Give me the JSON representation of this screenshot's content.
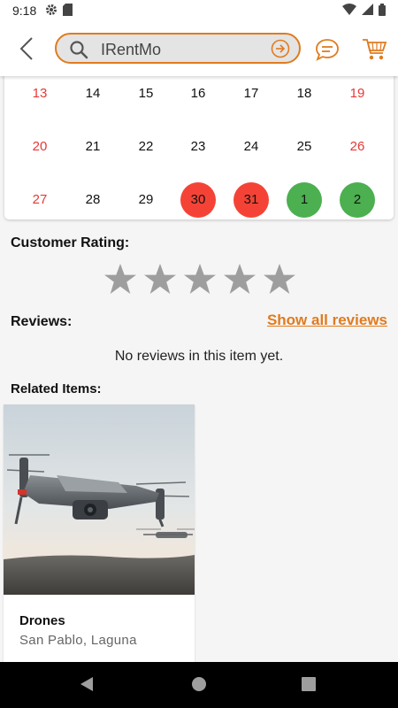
{
  "status_bar": {
    "time": "9:18",
    "left_icons": [
      "gear-icon",
      "sd-card-icon"
    ],
    "right_icons": [
      "wifi-icon",
      "signal-icon",
      "battery-icon"
    ]
  },
  "header": {
    "search": {
      "value": "IRentMo",
      "placeholder": ""
    },
    "icons": [
      "back-chevron-icon",
      "search-icon",
      "arrow-circle-right-icon",
      "chat-bubble-icon",
      "cart-icon"
    ],
    "accent_color": "#e07b1f"
  },
  "calendar": {
    "rows": [
      [
        {
          "label": "13",
          "state": "weekend"
        },
        {
          "label": "14",
          "state": "normal"
        },
        {
          "label": "15",
          "state": "normal"
        },
        {
          "label": "16",
          "state": "normal"
        },
        {
          "label": "17",
          "state": "normal"
        },
        {
          "label": "18",
          "state": "normal"
        },
        {
          "label": "19",
          "state": "weekend"
        }
      ],
      [
        {
          "label": "20",
          "state": "weekend"
        },
        {
          "label": "21",
          "state": "normal"
        },
        {
          "label": "22",
          "state": "normal"
        },
        {
          "label": "23",
          "state": "normal"
        },
        {
          "label": "24",
          "state": "normal"
        },
        {
          "label": "25",
          "state": "normal"
        },
        {
          "label": "26",
          "state": "weekend"
        }
      ],
      [
        {
          "label": "27",
          "state": "weekend"
        },
        {
          "label": "28",
          "state": "normal"
        },
        {
          "label": "29",
          "state": "normal"
        },
        {
          "label": "30",
          "state": "booked"
        },
        {
          "label": "31",
          "state": "booked"
        },
        {
          "label": "1",
          "state": "free"
        },
        {
          "label": "2",
          "state": "free"
        }
      ]
    ],
    "colors": {
      "weekend_text": "#e53935",
      "booked": "#f44336",
      "free": "#4caf50"
    }
  },
  "rating": {
    "title": "Customer Rating:",
    "value": 0,
    "max": 5,
    "star_color": "#9e9e9e"
  },
  "reviews": {
    "title": "Reviews:",
    "show_all_label": "Show all reviews",
    "empty_text": "No reviews in this item yet."
  },
  "related": {
    "title": "Related Items:",
    "items": [
      {
        "name": "Drones",
        "location": "San Pablo, Laguna",
        "image": "drone-photo"
      }
    ]
  },
  "nav_bar": {
    "icons": [
      "back-triangle-icon",
      "home-circle-icon",
      "recents-square-icon"
    ]
  }
}
